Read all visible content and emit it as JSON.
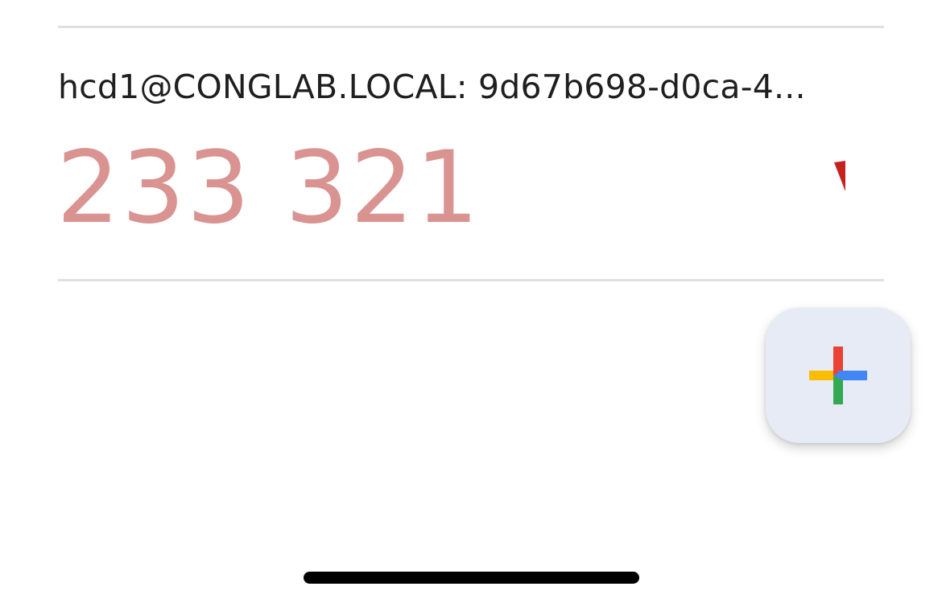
{
  "account": {
    "name": "hcd1@CONGLAB.LOCAL: 9d67b698-d0ca-4...",
    "code": "233 321",
    "code_color": "#d99391",
    "countdown_icon": "countdown-pie-icon",
    "countdown_color": "#c5221f"
  },
  "fab": {
    "icon": "add-plus-icon",
    "background": "#e7ebf5",
    "plus_colors": {
      "top": "#ea4335",
      "right": "#4285f4",
      "bottom": "#34a853",
      "left": "#fbbc04"
    }
  },
  "system": {
    "home_indicator": "home-indicator"
  }
}
